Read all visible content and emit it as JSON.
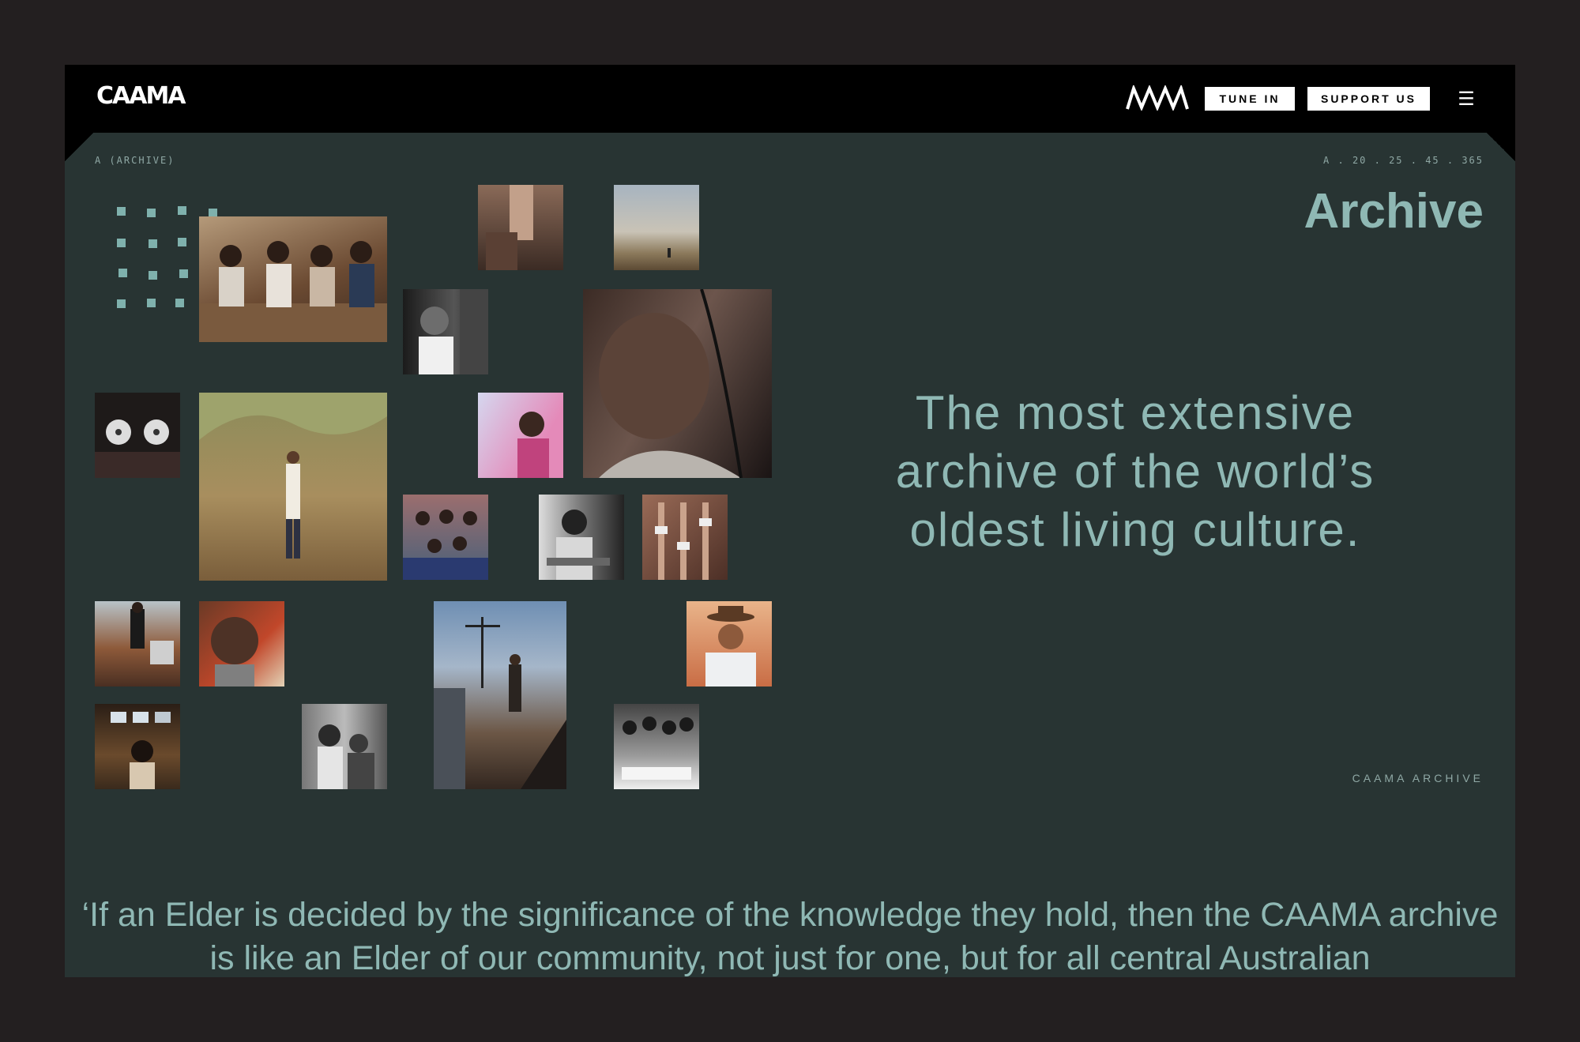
{
  "header": {
    "logo_text": "CAAMA",
    "tune_in_label": "TUNE IN",
    "support_label": "SUPPORT US",
    "menu_icon": "hamburger-icon",
    "mark_icon": "caama-wave-icon"
  },
  "page": {
    "breadcrumb": "A (ARCHIVE)",
    "code": "A . 20 . 25 . 45 . 365",
    "title": "Archive",
    "tagline": "The most extensive archive of the world’s oldest living culture.",
    "archive_label": "CAAMA ARCHIVE",
    "quote": "‘If an Elder is decided by the significance of the knowledge they hold, then the CAAMA archive is like an Elder of our community, not just for one, but for all central Australian"
  },
  "colors": {
    "background": "#231f20",
    "panel": "#283433",
    "accent": "#8fb8b4",
    "header": "#000000"
  }
}
